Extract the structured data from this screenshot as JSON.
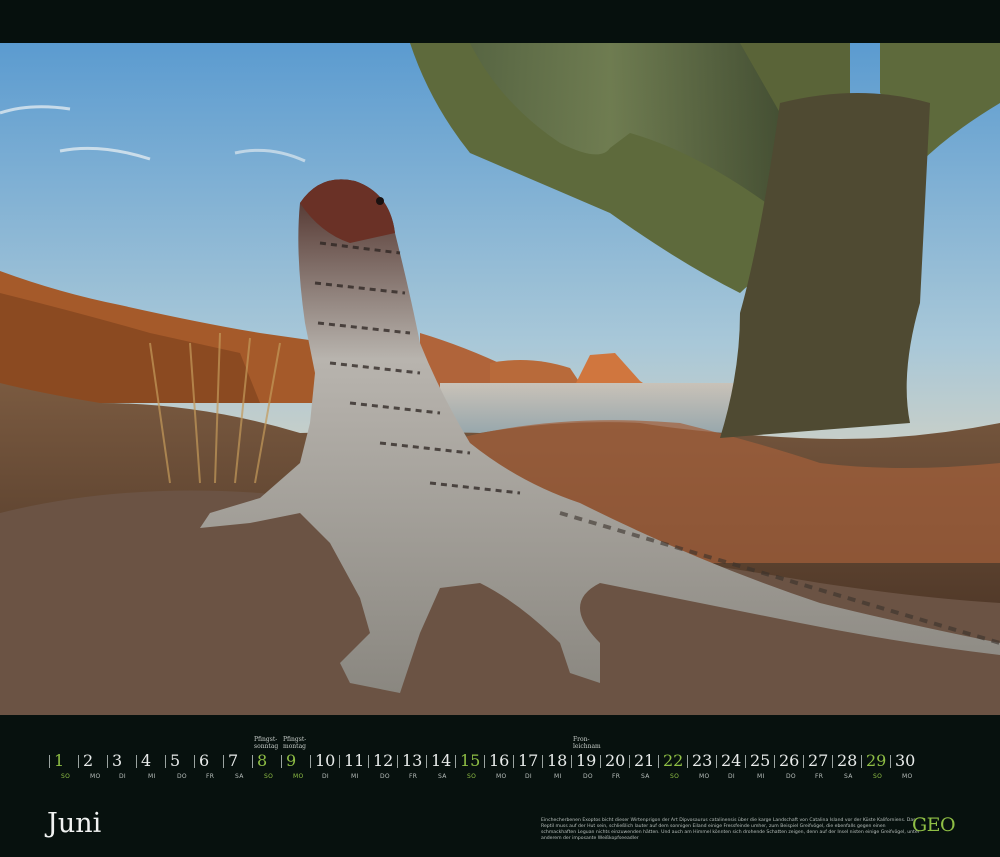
{
  "calendar": {
    "month": "Juni",
    "days": [
      {
        "n": "1",
        "w": "SO",
        "sun": true
      },
      {
        "n": "2",
        "w": "MO"
      },
      {
        "n": "3",
        "w": "DI"
      },
      {
        "n": "4",
        "w": "MI"
      },
      {
        "n": "5",
        "w": "DO"
      },
      {
        "n": "6",
        "w": "FR"
      },
      {
        "n": "7",
        "w": "SA"
      },
      {
        "n": "8",
        "w": "SO",
        "sun": true,
        "note": "Pfingst-\nsonntag"
      },
      {
        "n": "9",
        "w": "MO",
        "sun": true,
        "note": "Pfingst-\nmontag"
      },
      {
        "n": "10",
        "w": "DI"
      },
      {
        "n": "11",
        "w": "MI"
      },
      {
        "n": "12",
        "w": "DO"
      },
      {
        "n": "13",
        "w": "FR"
      },
      {
        "n": "14",
        "w": "SA"
      },
      {
        "n": "15",
        "w": "SO",
        "sun": true
      },
      {
        "n": "16",
        "w": "MO"
      },
      {
        "n": "17",
        "w": "DI"
      },
      {
        "n": "18",
        "w": "MI"
      },
      {
        "n": "19",
        "w": "DO",
        "note": "Fron-\nleichnam"
      },
      {
        "n": "20",
        "w": "FR"
      },
      {
        "n": "21",
        "w": "SA"
      },
      {
        "n": "22",
        "w": "SO",
        "sun": true
      },
      {
        "n": "23",
        "w": "MO"
      },
      {
        "n": "24",
        "w": "DI"
      },
      {
        "n": "25",
        "w": "MI"
      },
      {
        "n": "26",
        "w": "DO"
      },
      {
        "n": "27",
        "w": "FR"
      },
      {
        "n": "28",
        "w": "SA"
      },
      {
        "n": "29",
        "w": "SO",
        "sun": true
      },
      {
        "n": "30",
        "w": "MO"
      }
    ]
  },
  "caption": "Einchecherbenen Exoptos bicht dieser Wirtenprigon der Art Dipvosaurus catalinensis über die karge Landschaft von Catalina Island vor der Küste Kaliforniens. Das Reptil muss auf der Hut sein, schließlich lauter auf dem sonnigen Eiland einige Fressfeinde umher, zum Beispiel Greifvögel, die ebenfalls gegen einen schmackhaften Leguan nichts einzuwenden hätten. Und auch am Himmel könnten sich drohende Schatten zeigen, denn auf der Insel nisten einige Greifvögel, unter anderem der imposante Weißkopfseeadler",
  "logo": "GEO",
  "colors": {
    "accent": "#8fbf45",
    "band": "#07110e"
  }
}
